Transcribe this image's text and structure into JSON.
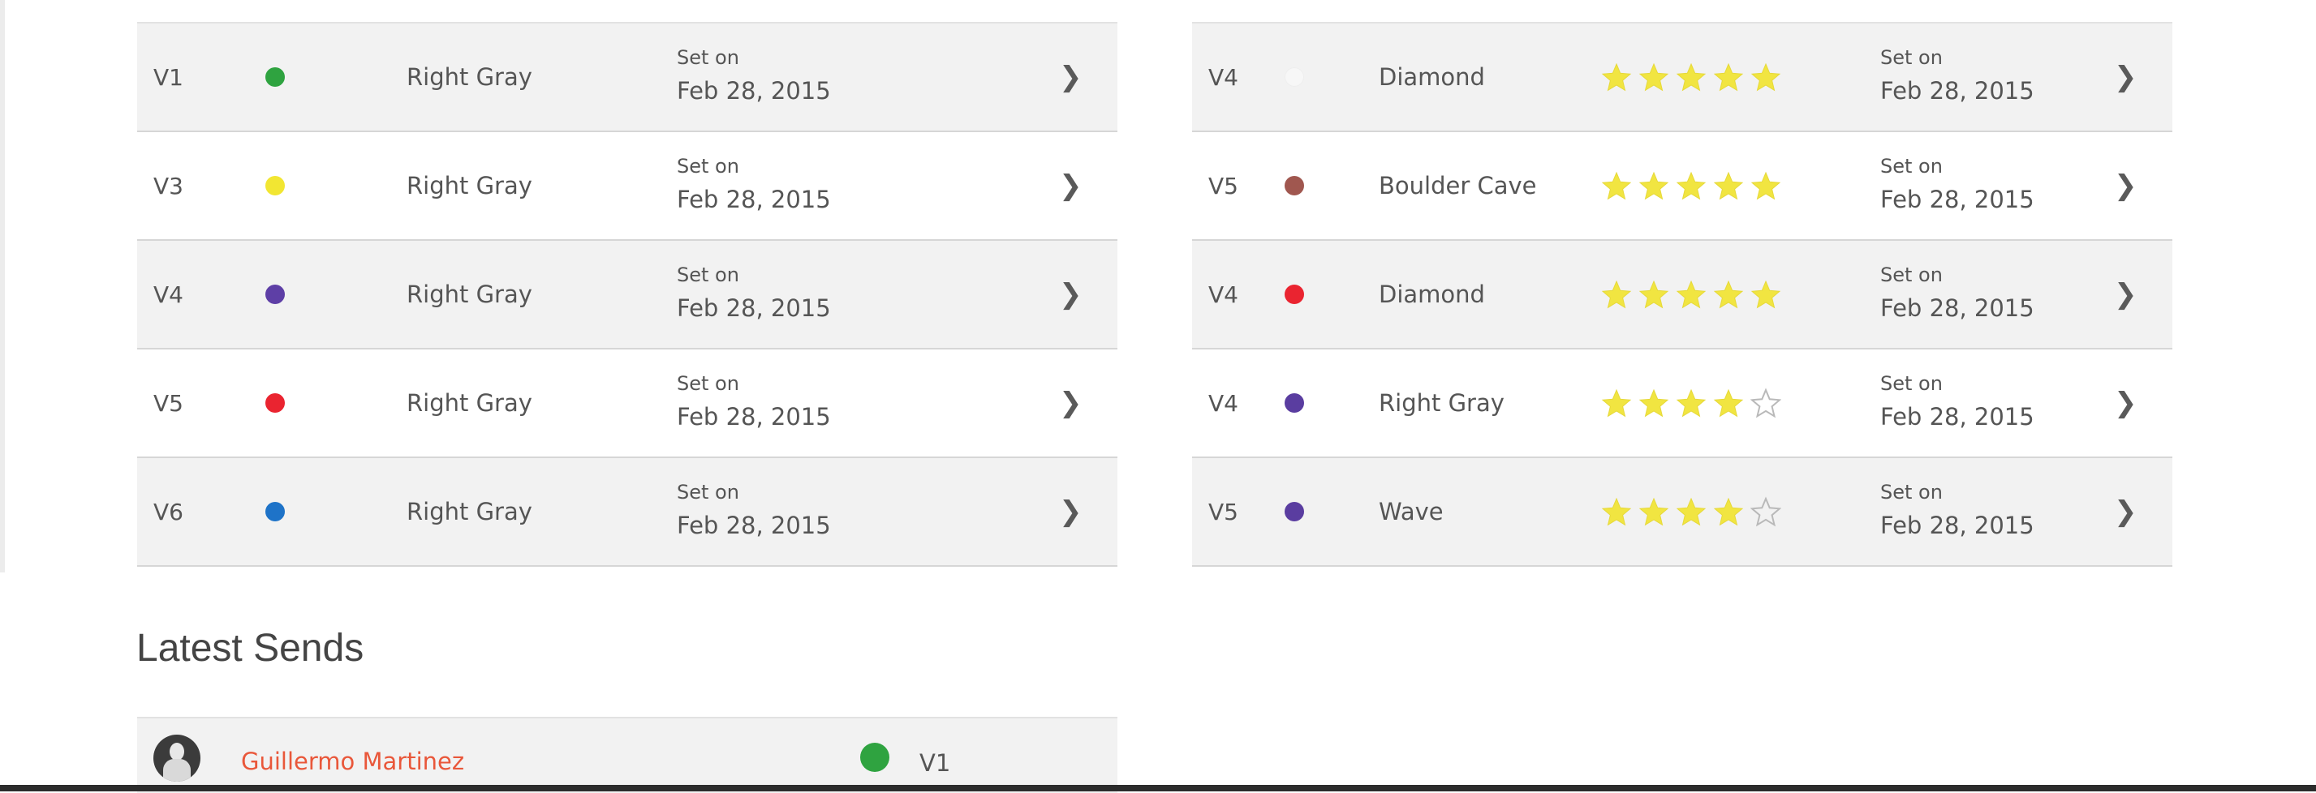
{
  "left_routes": [
    {
      "grade": "V1",
      "dot_color": "#2fa340",
      "area": "Right Gray",
      "set_label": "Set on",
      "date": "Feb 28, 2015",
      "chevron": "chevron-right-icon"
    },
    {
      "grade": "V3",
      "dot_color": "#f2e632",
      "area": "Right Gray",
      "set_label": "Set on",
      "date": "Feb 28, 2015",
      "chevron": "chevron-right-icon"
    },
    {
      "grade": "V4",
      "dot_color": "#5e3fa6",
      "area": "Right Gray",
      "set_label": "Set on",
      "date": "Feb 28, 2015",
      "chevron": "chevron-right-icon"
    },
    {
      "grade": "V5",
      "dot_color": "#ea2430",
      "area": "Right Gray",
      "set_label": "Set on",
      "date": "Feb 28, 2015",
      "chevron": "chevron-right-icon"
    },
    {
      "grade": "V6",
      "dot_color": "#1e73c8",
      "area": "Right Gray",
      "set_label": "Set on",
      "date": "Feb 28, 2015",
      "chevron": "chevron-right-icon"
    }
  ],
  "right_routes": [
    {
      "grade": "V4",
      "dot_color": "#f7f7f7",
      "area": "Diamond",
      "rating": 5,
      "set_label": "Set on",
      "date": "Feb 28, 2015",
      "chevron": "chevron-right-icon"
    },
    {
      "grade": "V5",
      "dot_color": "#a0574f",
      "area": "Boulder Cave",
      "rating": 5,
      "set_label": "Set on",
      "date": "Feb 28, 2015",
      "chevron": "chevron-right-icon"
    },
    {
      "grade": "V4",
      "dot_color": "#ea2430",
      "area": "Diamond",
      "rating": 5,
      "set_label": "Set on",
      "date": "Feb 28, 2015",
      "chevron": "chevron-right-icon"
    },
    {
      "grade": "V4",
      "dot_color": "#5a3da0",
      "area": "Right Gray",
      "rating": 4,
      "set_label": "Set on",
      "date": "Feb 28, 2015",
      "chevron": "chevron-right-icon"
    },
    {
      "grade": "V5",
      "dot_color": "#5a3da0",
      "area": "Wave",
      "rating": 4,
      "set_label": "Set on",
      "date": "Feb 28, 2015",
      "chevron": "chevron-right-icon"
    }
  ],
  "rating_max": 5,
  "latest_sends": {
    "title": "Latest Sends",
    "items": [
      {
        "name": "Guillermo Martinez",
        "dot_color": "#2fa340",
        "grade": "V1",
        "avatar": "user-avatar"
      }
    ]
  },
  "colors": {
    "accent_link": "#e9573a",
    "star_filled": "#f1e541",
    "row_alt_bg": "#f2f2f2"
  }
}
